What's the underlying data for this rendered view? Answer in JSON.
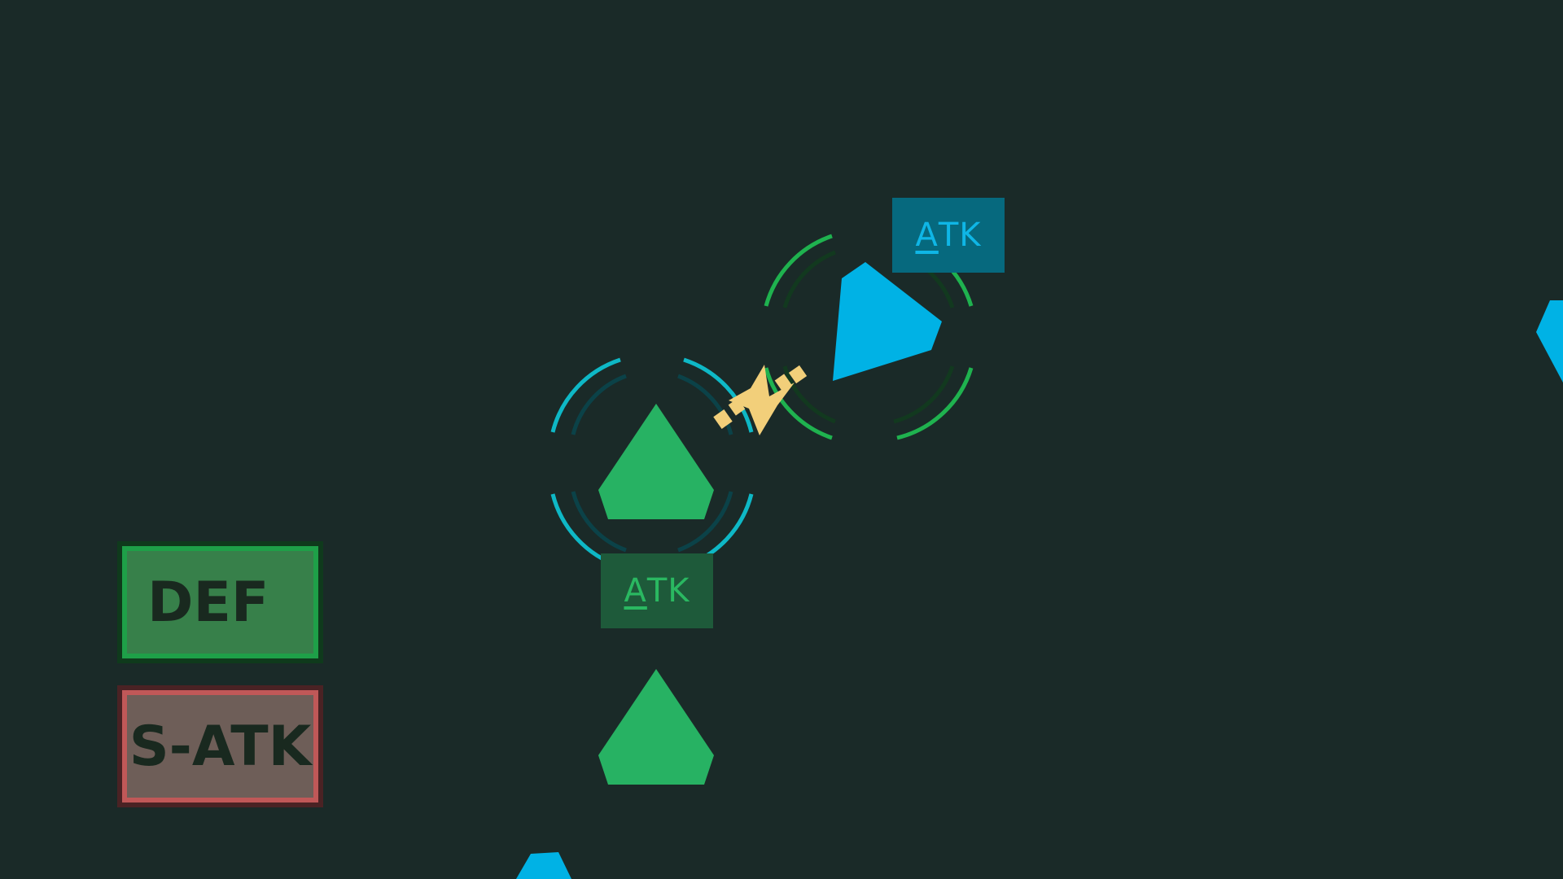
{
  "hud": {
    "def_button_label": "DEF",
    "satk_button_label": "S-ATK"
  },
  "units": {
    "enemy_tag": {
      "first": "A",
      "rest": "TK"
    },
    "player_tag": {
      "first": "A",
      "rest": "TK"
    }
  },
  "colors": {
    "background": "#1a2a28",
    "player_unit": "#27b263",
    "enemy_unit": "#00b2e5",
    "player_ring": "#1fb24f",
    "enemy_ring": "#0eb8c6",
    "clash_effect": "#f2cf7a",
    "def_button": "#37804a",
    "satk_button": "#6e5e58"
  },
  "icons": {
    "player_unit": "green-pentagon-icon",
    "enemy_unit": "blue-pentagon-icon",
    "clash": "spark-clash-icon"
  }
}
